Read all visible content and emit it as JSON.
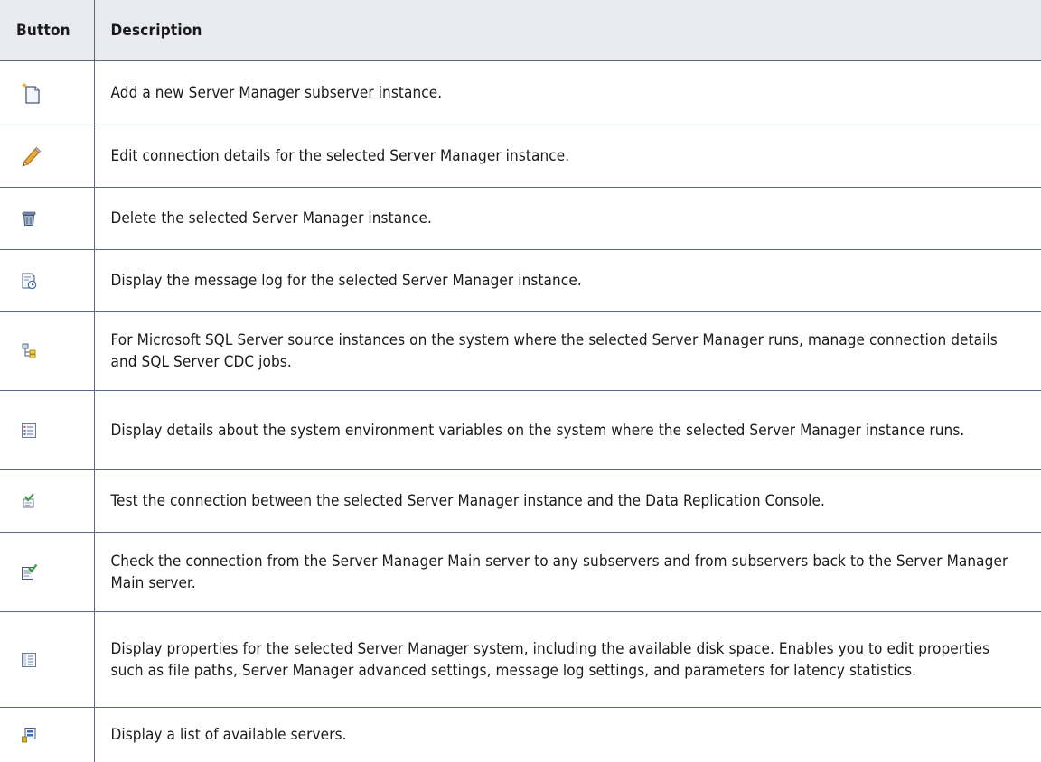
{
  "header": {
    "col_button": "Button",
    "col_description": "Description"
  },
  "rows": [
    {
      "icon": "add-subserver-icon",
      "description": "Add a new Server Manager subserver instance."
    },
    {
      "icon": "edit-pencil-icon",
      "description": "Edit connection details for the selected Server Manager instance."
    },
    {
      "icon": "delete-trash-icon",
      "description": "Delete the selected Server Manager instance."
    },
    {
      "icon": "message-log-icon",
      "description": "Display the message log for the selected Server Manager instance."
    },
    {
      "icon": "sql-server-cdc-icon",
      "description": "For Microsoft SQL Server source instances on the system where the selected Server Manager runs, manage connection details and SQL Server CDC jobs."
    },
    {
      "icon": "environment-variables-icon",
      "description": "Display details about the system environment variables on the system where the selected Server Manager instance runs."
    },
    {
      "icon": "test-connection-icon",
      "description": "Test the connection between the selected Server Manager instance and the Data Replication Console."
    },
    {
      "icon": "check-connection-icon",
      "description": "Check the connection from the Server Manager Main server to any subservers and from subservers back to the Server Manager Main server."
    },
    {
      "icon": "properties-icon",
      "description": "Display properties for the selected Server Manager system, including the available disk space. Enables you to edit properties such as file paths, Server Manager advanced settings, message log settings, and parameters for latency statistics."
    },
    {
      "icon": "server-list-icon",
      "description": "Display a list of available servers."
    }
  ]
}
